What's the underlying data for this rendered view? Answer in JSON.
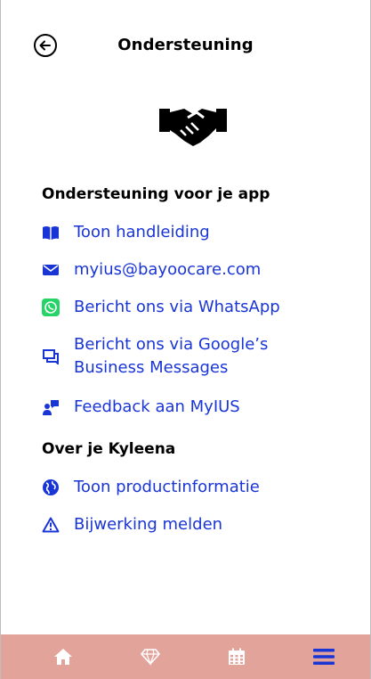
{
  "header": {
    "title": "Ondersteuning",
    "back_icon": "back-arrow-circle-icon"
  },
  "hero_icon": "handshake-icon",
  "colors": {
    "link": "#1a35d6",
    "tabbar_bg": "#e2a39b",
    "whatsapp_green": "#25d366",
    "active_tab": "#1a35d6"
  },
  "sections": [
    {
      "title": "Ondersteuning voor je app",
      "items": [
        {
          "icon": "book-icon",
          "label": "Toon handleiding"
        },
        {
          "icon": "envelope-icon",
          "label": "myius@bayoocare.com"
        },
        {
          "icon": "whatsapp-icon",
          "label": "Bericht ons via WhatsApp"
        },
        {
          "icon": "chat-icon",
          "label_line1": "Bericht ons via Google’s",
          "label_line2": "Business Messages"
        },
        {
          "icon": "feedback-icon",
          "label": "Feedback aan MyIUS"
        }
      ]
    },
    {
      "title": "Over je Kyleena",
      "items": [
        {
          "icon": "globe-icon",
          "label": "Toon productinformatie"
        },
        {
          "icon": "warning-icon",
          "label": "Bijwerking melden"
        }
      ]
    }
  ],
  "tabbar": {
    "tabs": [
      {
        "icon": "home-icon",
        "active": false
      },
      {
        "icon": "diamond-icon",
        "active": false
      },
      {
        "icon": "calendar-icon",
        "active": false
      },
      {
        "icon": "menu-icon",
        "active": true
      }
    ]
  }
}
